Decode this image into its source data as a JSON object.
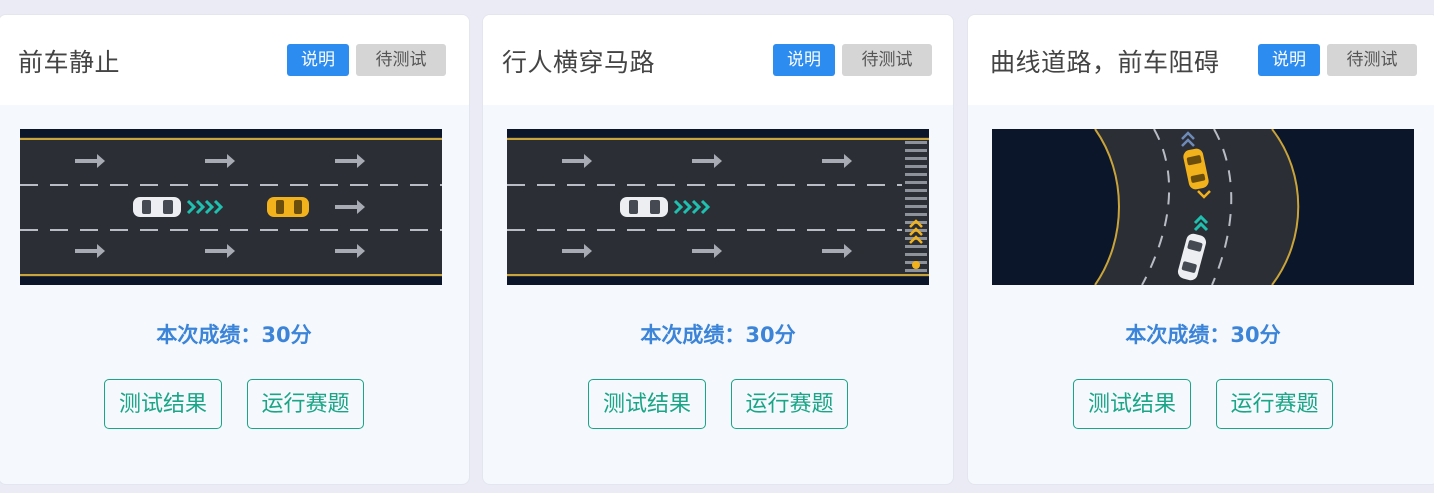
{
  "cards": [
    {
      "title": "前车静止",
      "desc_label": "说明",
      "status": "待测试",
      "score_label": "本次成绩：",
      "score_value": "30分",
      "result_button": "测试结果",
      "run_button": "运行赛题"
    },
    {
      "title": "行人横穿马路",
      "desc_label": "说明",
      "status": "待测试",
      "score_label": "本次成绩：",
      "score_value": "30分",
      "result_button": "测试结果",
      "run_button": "运行赛题"
    },
    {
      "title": "曲线道路，前车阻碍",
      "desc_label": "说明",
      "status": "待测试",
      "score_label": "本次成绩：",
      "score_value": "30分",
      "result_button": "测试结果",
      "run_button": "运行赛题"
    }
  ],
  "colors": {
    "page_bg": "#ebebf5",
    "card_bg": "#f5f8fd",
    "primary": "#2d8cf0",
    "status_bg": "#d5d5d5",
    "score": "#3b84d8",
    "outline_button": "#1aa686"
  }
}
